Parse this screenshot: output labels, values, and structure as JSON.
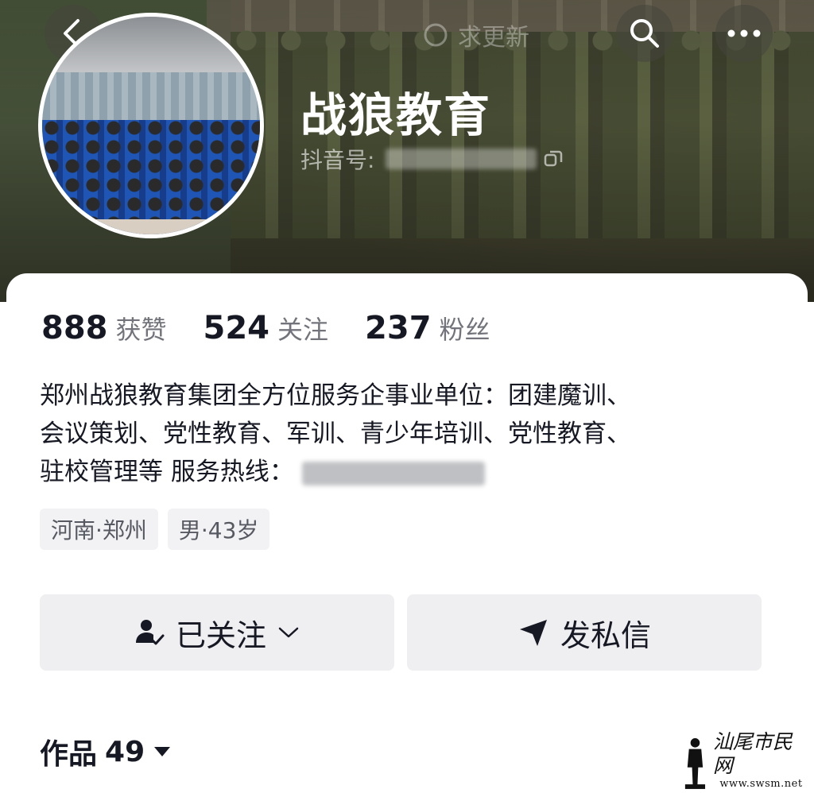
{
  "header": {
    "update_hint": "求更新",
    "nickname": "战狼教育",
    "douyin_id_label": "抖音号:"
  },
  "stats": [
    {
      "value": "888",
      "label": "获赞"
    },
    {
      "value": "524",
      "label": "关注"
    },
    {
      "value": "237",
      "label": "粉丝"
    }
  ],
  "bio": {
    "line1": "郑州战狼教育集团全方位服务企事业单位：团建魔训、",
    "line2": "会议策划、党性教育、军训、青少年培训、党性教育、",
    "line3": "驻校管理等 服务热线："
  },
  "tags": [
    "河南·郑州",
    "男·43岁"
  ],
  "actions": {
    "followed_label": "已关注",
    "message_label": "发私信"
  },
  "works": {
    "label": "作品",
    "count": "49"
  },
  "watermark": {
    "name": "汕尾市民网",
    "url": "www.swsm.net"
  },
  "icons": {
    "back": "chevron-left-icon",
    "search": "search-icon",
    "more": "more-dots-icon",
    "copy": "copy-icon",
    "follow_user": "user-check-icon",
    "dropdown": "chevron-down-icon",
    "send": "send-icon",
    "works_caret": "caret-down-icon"
  },
  "colors": {
    "text_primary": "#161823",
    "button_bg": "#efeff1",
    "tag_bg": "#f2f2f4"
  }
}
